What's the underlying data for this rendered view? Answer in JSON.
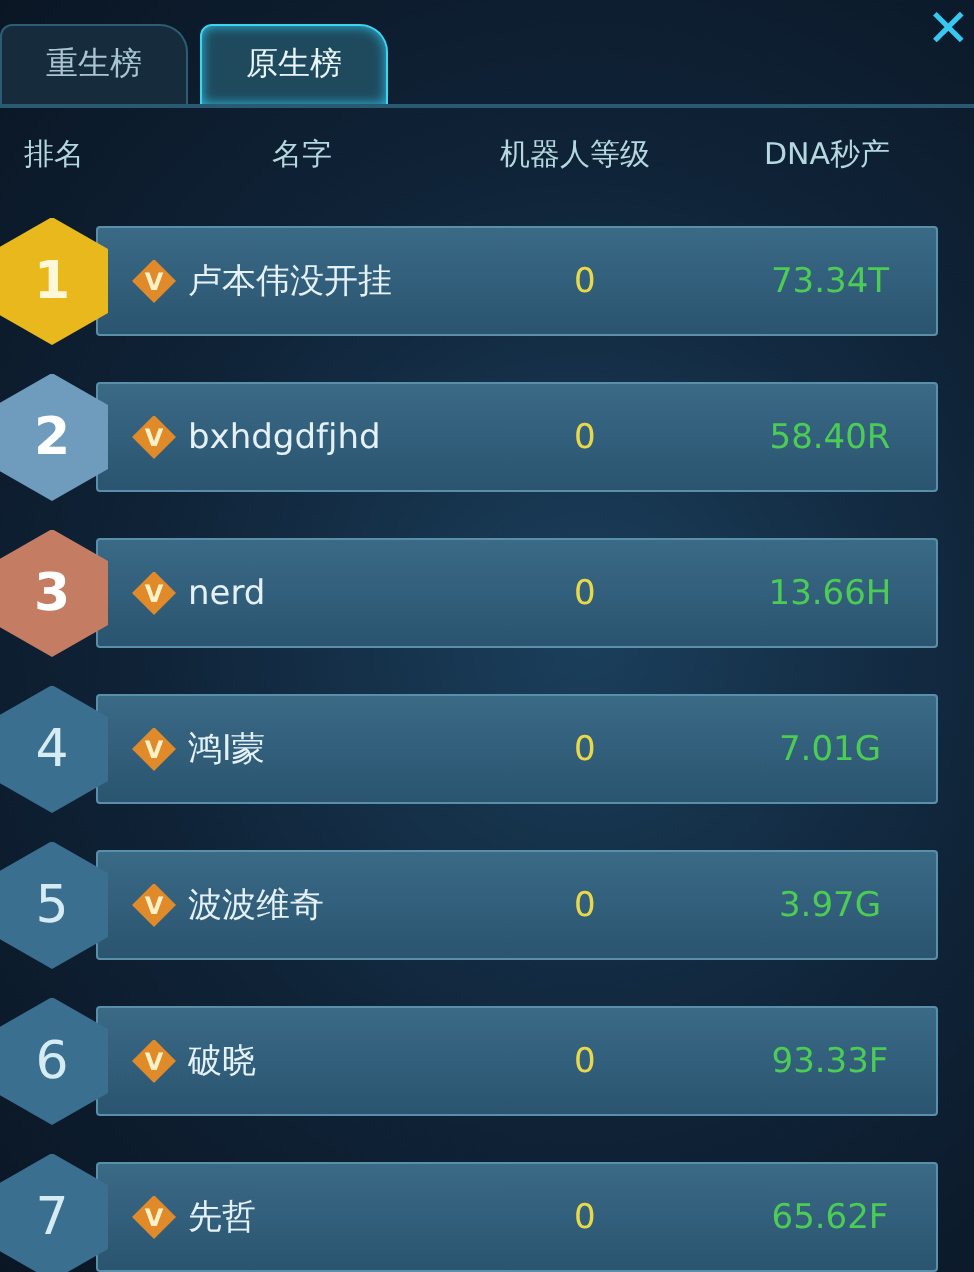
{
  "tabs": [
    {
      "label": "重生榜",
      "selected": false
    },
    {
      "label": "原生榜",
      "selected": true
    }
  ],
  "close": "✕",
  "columns": [
    "排名",
    "名字",
    "机器人等级",
    "DNA秒产"
  ],
  "rows": [
    {
      "rank": "1",
      "kind": "gold",
      "vip": "V",
      "name": "卢本伟没开挂",
      "level_text": "0",
      "dna": "73.34T"
    },
    {
      "rank": "2",
      "kind": "silver",
      "vip": "V",
      "name": "bxhdgdfjhd",
      "level_text": "0",
      "dna": "58.40R"
    },
    {
      "rank": "3",
      "kind": "bronze",
      "vip": "V",
      "name": "nerd",
      "level_text": "0",
      "dna": "13.66H"
    },
    {
      "rank": "4",
      "kind": "plain",
      "vip": "V",
      "name": "鸿l蒙",
      "level_text": "0",
      "dna": "7.01G"
    },
    {
      "rank": "5",
      "kind": "plain",
      "vip": "V",
      "name": "波波维奇",
      "level_text": "0",
      "dna": "3.97G"
    },
    {
      "rank": "6",
      "kind": "plain",
      "vip": "V",
      "name": "破晓",
      "level_text": "0",
      "dna": "93.33F"
    },
    {
      "rank": "7",
      "kind": "plain",
      "vip": "V",
      "name": "先哲",
      "level_text": "0",
      "dna": "65.62F"
    }
  ]
}
